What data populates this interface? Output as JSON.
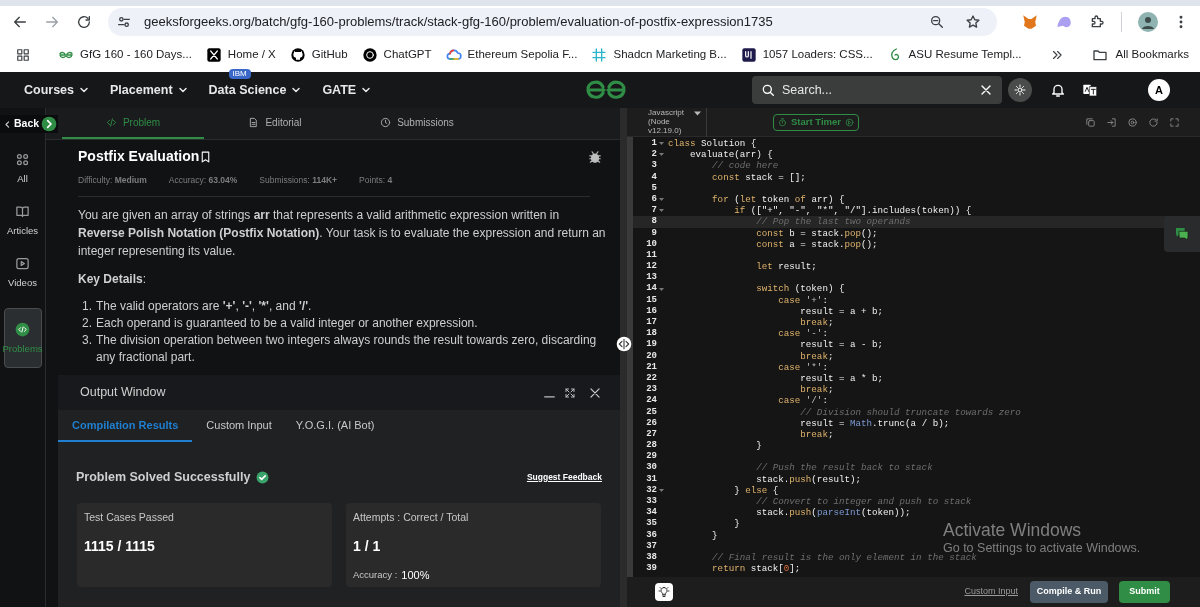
{
  "browser": {
    "url": "geeksforgeeks.org/batch/gfg-160-problems/track/stack-gfg-160/problem/evaluation-of-postfix-expression1735",
    "bookmarks": [
      {
        "label": "GfG 160 - 160 Days...",
        "kind": "gfg"
      },
      {
        "label": "Home / X",
        "kind": "x"
      },
      {
        "label": "GitHub",
        "kind": "github"
      },
      {
        "label": "ChatGPT",
        "kind": "chatgpt"
      },
      {
        "label": "Ethereum Sepolia F...",
        "kind": "cloud"
      },
      {
        "label": "Shadcn Marketing B...",
        "kind": "hash"
      },
      {
        "label": "1057 Loaders: CSS...",
        "kind": "ui"
      },
      {
        "label": "ASU Resume Templ...",
        "kind": "leaf"
      }
    ],
    "all_bookmarks": "All Bookmarks"
  },
  "nav": {
    "items": [
      {
        "label": "Courses"
      },
      {
        "label": "Placement"
      },
      {
        "label": "Data Science",
        "badge": "IBM"
      },
      {
        "label": "GATE"
      }
    ],
    "search": {
      "placeholder": "Search..."
    },
    "avatar": "A"
  },
  "sidebar": {
    "back": "Back",
    "items": [
      {
        "label": "All",
        "kind": "all",
        "selected": false
      },
      {
        "label": "Articles",
        "kind": "articles",
        "selected": false
      },
      {
        "label": "Videos",
        "kind": "videos",
        "selected": false
      },
      {
        "label": "Problems",
        "kind": "problems",
        "selected": true
      }
    ]
  },
  "problem_tabs": [
    {
      "label": "Problem",
      "kind": "code",
      "selected": true
    },
    {
      "label": "Editorial",
      "kind": "doc",
      "selected": false
    },
    {
      "label": "Submissions",
      "kind": "clock",
      "selected": false
    }
  ],
  "problem": {
    "title": "Postfix Evaluation",
    "meta": [
      "Difficulty: **Medium**",
      "Accuracy: **63.04%**",
      "Submissions: **114K+**",
      "Points: **4**"
    ],
    "description": "You are given an array of strings **arr** that represents a valid arithmetic expression written in **Reverse Polish Notation (Postfix Notation)**. Your task is to evaluate the expression and return an integer representing its value.",
    "key_details": "**Key Details**:",
    "details": [
      {
        "num": "1.",
        "text": "The valid operators are **'+'**, **'-'**, **'*'**, and **'/'**."
      },
      {
        "num": "2.",
        "text": "Each operand is guaranteed to be a valid integer or another expression."
      },
      {
        "num": "3.",
        "text": "The division operation between two integers always rounds the result towards zero, discarding any fractional part."
      }
    ]
  },
  "output": {
    "title": "Output Window",
    "tabs": [
      {
        "label": "Compilation Results",
        "selected": true
      },
      {
        "label": "Custom Input",
        "selected": false
      },
      {
        "label": "Y.O.G.I. (AI Bot)",
        "selected": false
      }
    ],
    "status": "Problem Solved Successfully",
    "feedback": "Suggest Feedback",
    "cards": [
      {
        "label": "Test Cases Passed",
        "value": "1115 / 1115"
      },
      {
        "label": "Attempts : Correct / Total",
        "value": "1 / 1",
        "extra_label": "Accuracy :",
        "extra_value": "100%"
      }
    ]
  },
  "editor": {
    "language": "Javascript (Node v12.19.0)",
    "timer": "Start Timer",
    "lines": [
      {
        "n": "1",
        "fold": true,
        "active": false,
        "t": [
          {
            "kind": "keyword",
            "text": "class"
          },
          {
            "kind": "plain",
            "text": " Solution {"
          }
        ]
      },
      {
        "n": "2",
        "fold": true,
        "active": false,
        "t": [
          {
            "kind": "plain",
            "text": "    evaluate(arr) {"
          }
        ]
      },
      {
        "n": "3",
        "fold": false,
        "active": false,
        "t": [
          {
            "kind": "comment",
            "text": "        // code here"
          }
        ]
      },
      {
        "n": "4",
        "fold": false,
        "active": false,
        "t": [
          {
            "kind": "keyword",
            "text": "        const"
          },
          {
            "kind": "plain",
            "text": " stack = [];"
          }
        ]
      },
      {
        "n": "5",
        "fold": false,
        "active": false
      },
      {
        "n": "6",
        "fold": true,
        "active": false,
        "t": [
          {
            "kind": "keyword",
            "text": "        for"
          },
          {
            "kind": "plain",
            "text": " ("
          },
          {
            "kind": "keyword",
            "text": "let"
          },
          {
            "kind": "plain",
            "text": " token "
          },
          {
            "kind": "keyword",
            "text": "of"
          },
          {
            "kind": "plain",
            "text": " arr) {"
          }
        ]
      },
      {
        "n": "7",
        "fold": true,
        "active": false,
        "t": [
          {
            "kind": "keyword",
            "text": "            if"
          },
          {
            "kind": "plain",
            "text": " ([\"+\", \"-\", \"*\", \"/\"].includes(token)) {"
          }
        ]
      },
      {
        "n": "8",
        "fold": false,
        "active": true,
        "t": [
          {
            "kind": "comment",
            "text": "                // Pop the last two operands"
          }
        ]
      },
      {
        "n": "9",
        "fold": false,
        "active": false,
        "t": [
          {
            "kind": "keyword",
            "text": "                const"
          },
          {
            "kind": "plain",
            "text": " b = stack."
          },
          {
            "kind": "method",
            "text": "pop"
          },
          {
            "kind": "plain",
            "text": "();"
          }
        ]
      },
      {
        "n": "10",
        "fold": false,
        "active": false,
        "t": [
          {
            "kind": "keyword",
            "text": "                const"
          },
          {
            "kind": "plain",
            "text": " a = stack."
          },
          {
            "kind": "method",
            "text": "pop"
          },
          {
            "kind": "plain",
            "text": "();"
          }
        ]
      },
      {
        "n": "11",
        "fold": false,
        "active": false
      },
      {
        "n": "12",
        "fold": false,
        "active": false,
        "t": [
          {
            "kind": "keyword",
            "text": "                let"
          },
          {
            "kind": "plain",
            "text": " result;"
          }
        ]
      },
      {
        "n": "13",
        "fold": false,
        "active": false
      },
      {
        "n": "14",
        "fold": true,
        "active": false,
        "t": [
          {
            "kind": "keyword",
            "text": "                switch"
          },
          {
            "kind": "plain",
            "text": " (token) {"
          }
        ]
      },
      {
        "n": "15",
        "fold": false,
        "active": false,
        "t": [
          {
            "kind": "keyword",
            "text": "                    case"
          },
          {
            "kind": "string",
            "text": " '+'"
          },
          {
            "kind": "plain",
            "text": ":"
          }
        ]
      },
      {
        "n": "16",
        "fold": false,
        "active": false,
        "t": [
          {
            "kind": "plain",
            "text": "                        result = a + b;"
          }
        ]
      },
      {
        "n": "17",
        "fold": false,
        "active": false,
        "t": [
          {
            "kind": "keyword",
            "text": "                        break"
          },
          {
            "kind": "plain",
            "text": ";"
          }
        ]
      },
      {
        "n": "18",
        "fold": false,
        "active": false,
        "t": [
          {
            "kind": "keyword",
            "text": "                    case"
          },
          {
            "kind": "string",
            "text": " '-'"
          },
          {
            "kind": "plain",
            "text": ":"
          }
        ]
      },
      {
        "n": "19",
        "fold": false,
        "active": false,
        "t": [
          {
            "kind": "plain",
            "text": "                        result = a - b;"
          }
        ]
      },
      {
        "n": "20",
        "fold": false,
        "active": false,
        "t": [
          {
            "kind": "keyword",
            "text": "                        break"
          },
          {
            "kind": "plain",
            "text": ";"
          }
        ]
      },
      {
        "n": "21",
        "fold": false,
        "active": false,
        "t": [
          {
            "kind": "keyword",
            "text": "                    case"
          },
          {
            "kind": "string",
            "text": " '*'"
          },
          {
            "kind": "plain",
            "text": ":"
          }
        ]
      },
      {
        "n": "22",
        "fold": false,
        "active": false,
        "t": [
          {
            "kind": "plain",
            "text": "                        result = a * b;"
          }
        ]
      },
      {
        "n": "23",
        "fold": false,
        "active": false,
        "t": [
          {
            "kind": "keyword",
            "text": "                        break"
          },
          {
            "kind": "plain",
            "text": ";"
          }
        ]
      },
      {
        "n": "24",
        "fold": false,
        "active": false,
        "t": [
          {
            "kind": "keyword",
            "text": "                    case"
          },
          {
            "kind": "string",
            "text": " '/'"
          },
          {
            "kind": "plain",
            "text": ":"
          }
        ]
      },
      {
        "n": "25",
        "fold": false,
        "active": false,
        "t": [
          {
            "kind": "comment",
            "text": "                        // Division should truncate towards zero"
          }
        ]
      },
      {
        "n": "26",
        "fold": false,
        "active": false,
        "t": [
          {
            "kind": "plain",
            "text": "                        result = "
          },
          {
            "kind": "builtin",
            "text": "Math"
          },
          {
            "kind": "plain",
            "text": ".trunc(a / b);"
          }
        ]
      },
      {
        "n": "27",
        "fold": false,
        "active": false,
        "t": [
          {
            "kind": "keyword",
            "text": "                        break"
          },
          {
            "kind": "plain",
            "text": ";"
          }
        ]
      },
      {
        "n": "28",
        "fold": false,
        "active": false,
        "t": [
          {
            "kind": "plain",
            "text": "                }"
          }
        ]
      },
      {
        "n": "29",
        "fold": false,
        "active": false
      },
      {
        "n": "30",
        "fold": false,
        "active": false,
        "t": [
          {
            "kind": "comment",
            "text": "                // Push the result back to stack"
          }
        ]
      },
      {
        "n": "31",
        "fold": false,
        "active": false,
        "t": [
          {
            "kind": "plain",
            "text": "                stack."
          },
          {
            "kind": "method",
            "text": "push"
          },
          {
            "kind": "plain",
            "text": "(result);"
          }
        ]
      },
      {
        "n": "32",
        "fold": true,
        "active": false,
        "t": [
          {
            "kind": "plain",
            "text": "            }"
          },
          {
            "kind": "keyword",
            "text": " else"
          },
          {
            "kind": "plain",
            "text": " {"
          }
        ]
      },
      {
        "n": "33",
        "fold": false,
        "active": false,
        "t": [
          {
            "kind": "comment",
            "text": "                // Convert to integer and push to stack"
          }
        ]
      },
      {
        "n": "34",
        "fold": false,
        "active": false,
        "t": [
          {
            "kind": "plain",
            "text": "                stack."
          },
          {
            "kind": "method",
            "text": "push"
          },
          {
            "kind": "plain",
            "text": "("
          },
          {
            "kind": "builtin",
            "text": "parseInt"
          },
          {
            "kind": "plain",
            "text": "(token));"
          }
        ]
      },
      {
        "n": "35",
        "fold": false,
        "active": false,
        "t": [
          {
            "kind": "plain",
            "text": "            }"
          }
        ]
      },
      {
        "n": "36",
        "fold": false,
        "active": false,
        "t": [
          {
            "kind": "plain",
            "text": "        }"
          }
        ]
      },
      {
        "n": "37",
        "fold": false,
        "active": false
      },
      {
        "n": "38",
        "fold": false,
        "active": false,
        "t": [
          {
            "kind": "comment",
            "text": "        // Final result is the only element in the stack"
          }
        ]
      },
      {
        "n": "39",
        "fold": false,
        "active": false,
        "t": [
          {
            "kind": "keyword",
            "text": "        return"
          },
          {
            "kind": "plain",
            "text": " stack["
          },
          {
            "kind": "number",
            "text": "0"
          },
          {
            "kind": "plain",
            "text": "];"
          }
        ]
      }
    ],
    "footer": {
      "custom_input": "Custom Input",
      "run": "Compile & Run",
      "submit": "Submit"
    }
  },
  "os_notice": {
    "title": "Activate Windows",
    "text": "Go to Settings to activate Windows."
  }
}
